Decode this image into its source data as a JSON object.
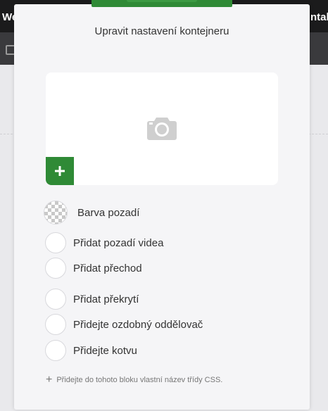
{
  "background": {
    "left_text": "We",
    "right_text": "ntak"
  },
  "modal": {
    "title": "Upravit nastavení kontejneru",
    "options": {
      "background_color": "Barva pozadí",
      "video_background": "Přidat pozadí videa",
      "transition": "Přidat přechod",
      "overlay": "Přidat překrytí",
      "divider": "Přidejte ozdobný oddělovač",
      "anchor": "Přidejte kotvu"
    },
    "css_class_link": "Přidejte do tohoto bloku vlastní název třídy CSS."
  },
  "colors": {
    "accent": "#2f8a36",
    "topbar": "#1b1b1c",
    "modal_bg": "#f5f5f7"
  },
  "icons": {
    "image_placeholder": "camera-icon",
    "add_image": "plus-icon",
    "add_css": "plus-icon"
  }
}
